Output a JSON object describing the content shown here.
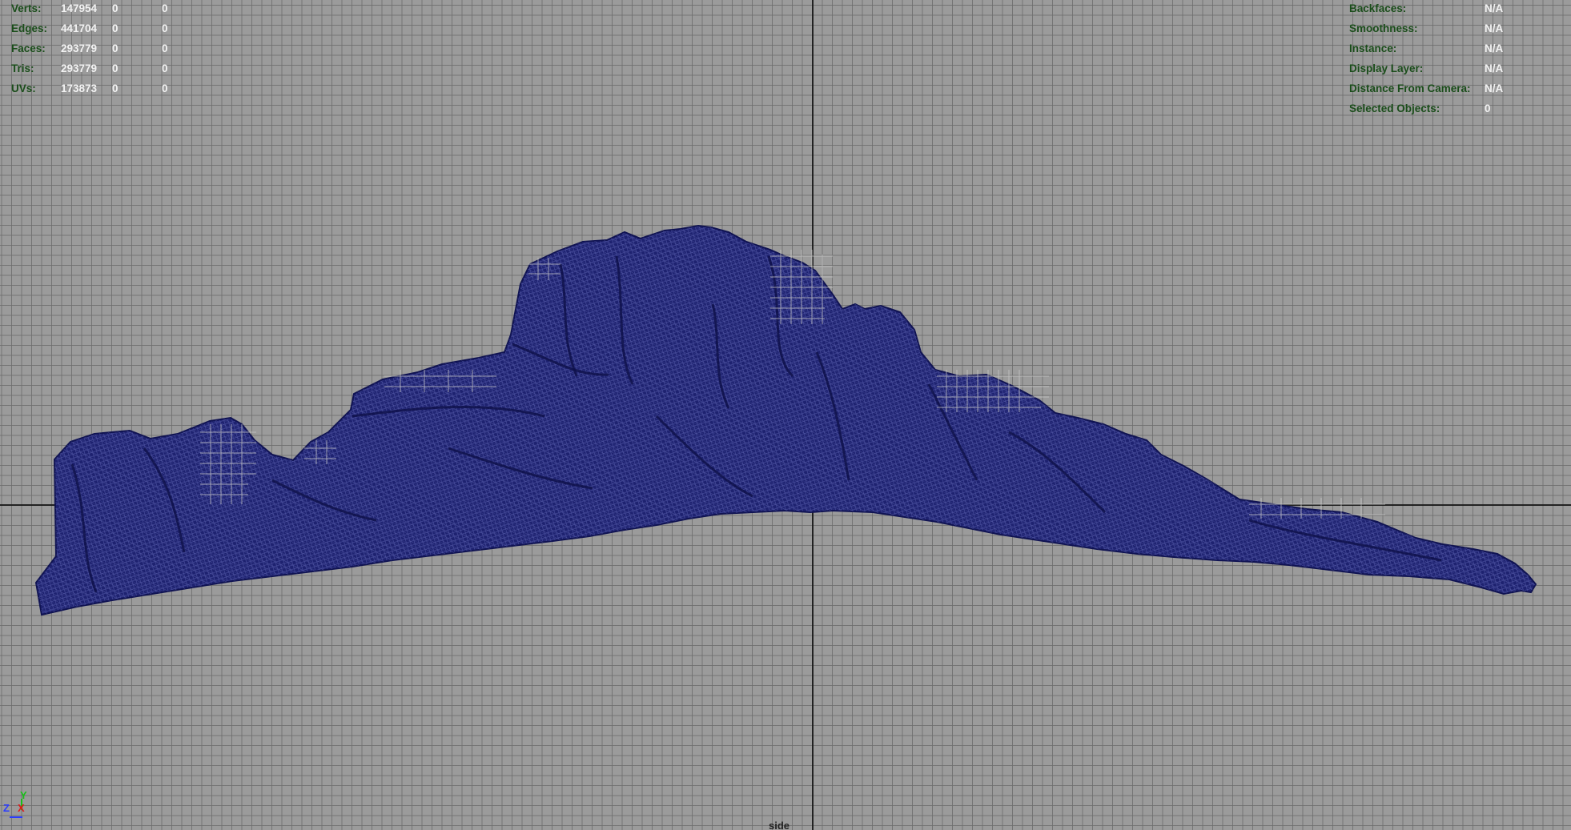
{
  "stats": {
    "rows": [
      {
        "label": "Verts:",
        "v1": "147954",
        "v2": "0",
        "v3": "0"
      },
      {
        "label": "Edges:",
        "v1": "441704",
        "v2": "0",
        "v3": "0"
      },
      {
        "label": "Faces:",
        "v1": "293779",
        "v2": "0",
        "v3": "0"
      },
      {
        "label": "Tris:",
        "v1": "293779",
        "v2": "0",
        "v3": "0"
      },
      {
        "label": "UVs:",
        "v1": "173873",
        "v2": "0",
        "v3": "0"
      }
    ]
  },
  "info": {
    "rows": [
      {
        "label": "Backfaces:",
        "value": "N/A"
      },
      {
        "label": "Smoothness:",
        "value": "N/A"
      },
      {
        "label": "Instance:",
        "value": "N/A"
      },
      {
        "label": "Display Layer:",
        "value": "N/A"
      },
      {
        "label": "Distance From Camera:",
        "value": "N/A"
      },
      {
        "label": "Selected Objects:",
        "value": "0"
      }
    ]
  },
  "camera": {
    "label": "side"
  },
  "gizmo": {
    "y": "Y",
    "z": "Z",
    "x": "X"
  },
  "colors": {
    "background": "#9b9b9b",
    "grid": "#6e6e6e",
    "mesh_fill": "#1c1f6b",
    "mesh_wire": "#2f3590",
    "hud_label": "#1a4d1a",
    "hud_value": "#f2f2f2"
  }
}
